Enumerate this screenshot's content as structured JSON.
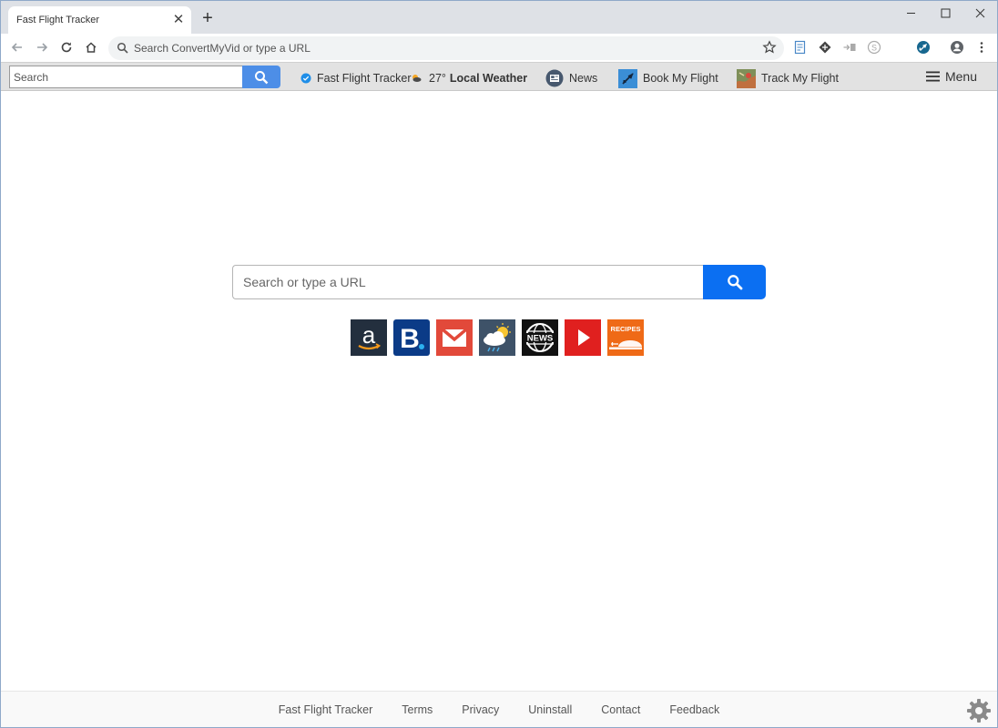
{
  "browser": {
    "tab_title": "Fast Flight Tracker",
    "omnibox_placeholder": "Search ConvertMyVid or type a URL"
  },
  "extension_bar": {
    "search_placeholder": "Search",
    "links": {
      "tracker": "Fast Flight Tracker",
      "temperature": "27°",
      "weather": "Local Weather",
      "news": "News",
      "book": "Book My Flight",
      "track": "Track My Flight"
    },
    "menu_label": "Menu"
  },
  "main": {
    "search_placeholder": "Search or type a URL",
    "tiles": [
      {
        "icon": "amazon-icon",
        "color": "#232f3e"
      },
      {
        "icon": "booking-icon",
        "color": "#0b3b87"
      },
      {
        "icon": "gmail-icon",
        "color": "#e2493a"
      },
      {
        "icon": "weather-icon",
        "color": "#3e5268"
      },
      {
        "icon": "news-icon",
        "color": "#111111"
      },
      {
        "icon": "youtube-icon",
        "color": "#e0201f"
      },
      {
        "icon": "recipes-icon",
        "color": "#ef6a17",
        "label": "RECIPES"
      }
    ]
  },
  "footer": {
    "links": [
      "Fast Flight Tracker",
      "Terms",
      "Privacy",
      "Uninstall",
      "Contact",
      "Feedback"
    ]
  },
  "colors": {
    "accent_blue": "#0b6ff2",
    "extension_search_blue": "#4d8ee7"
  }
}
